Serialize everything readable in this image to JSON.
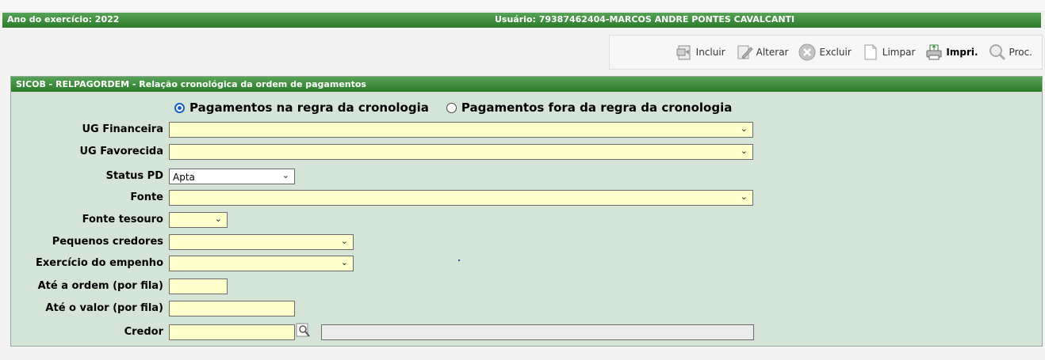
{
  "header": {
    "year_label": "Ano do exercício: 2022",
    "user_label": "Usuário: 79387462404-MARCOS ANDRE PONTES CAVALCANTI"
  },
  "toolbar": {
    "incluir": "Incluir",
    "alterar": "Alterar",
    "excluir": "Excluir",
    "limpar": "Limpar",
    "imprimir": "Impri.",
    "procurar": "Proc."
  },
  "panel": {
    "title": "SICOB - RELPAGORDEM - Relação cronológica da ordem de pagamentos"
  },
  "radios": {
    "option1": "Pagamentos na regra da cronologia",
    "option2": "Pagamentos fora da regra da cronologia",
    "selected": "option1"
  },
  "form": {
    "ug_financeira": {
      "label": "UG Financeira",
      "value": ""
    },
    "ug_favorecida": {
      "label": "UG Favorecida",
      "value": ""
    },
    "status_pd": {
      "label": "Status PD",
      "value": "Apta"
    },
    "fonte": {
      "label": "Fonte",
      "value": ""
    },
    "fonte_tesouro": {
      "label": "Fonte tesouro",
      "value": ""
    },
    "pequenos_credores": {
      "label": "Pequenos credores",
      "value": ""
    },
    "exercicio_empenho": {
      "label": "Exercício do empenho",
      "value": ""
    },
    "ate_ordem": {
      "label": "Até a ordem (por fila)",
      "value": ""
    },
    "ate_valor": {
      "label": "Até o valor (por fila)",
      "value": ""
    },
    "credor": {
      "label": "Credor",
      "value": "",
      "name_value": ""
    }
  },
  "colors": {
    "header_green": "#2c7a2c",
    "panel_bg": "#d4e4d6",
    "field_bg": "#ffffcc",
    "radio_accent": "#1a5fc8"
  }
}
